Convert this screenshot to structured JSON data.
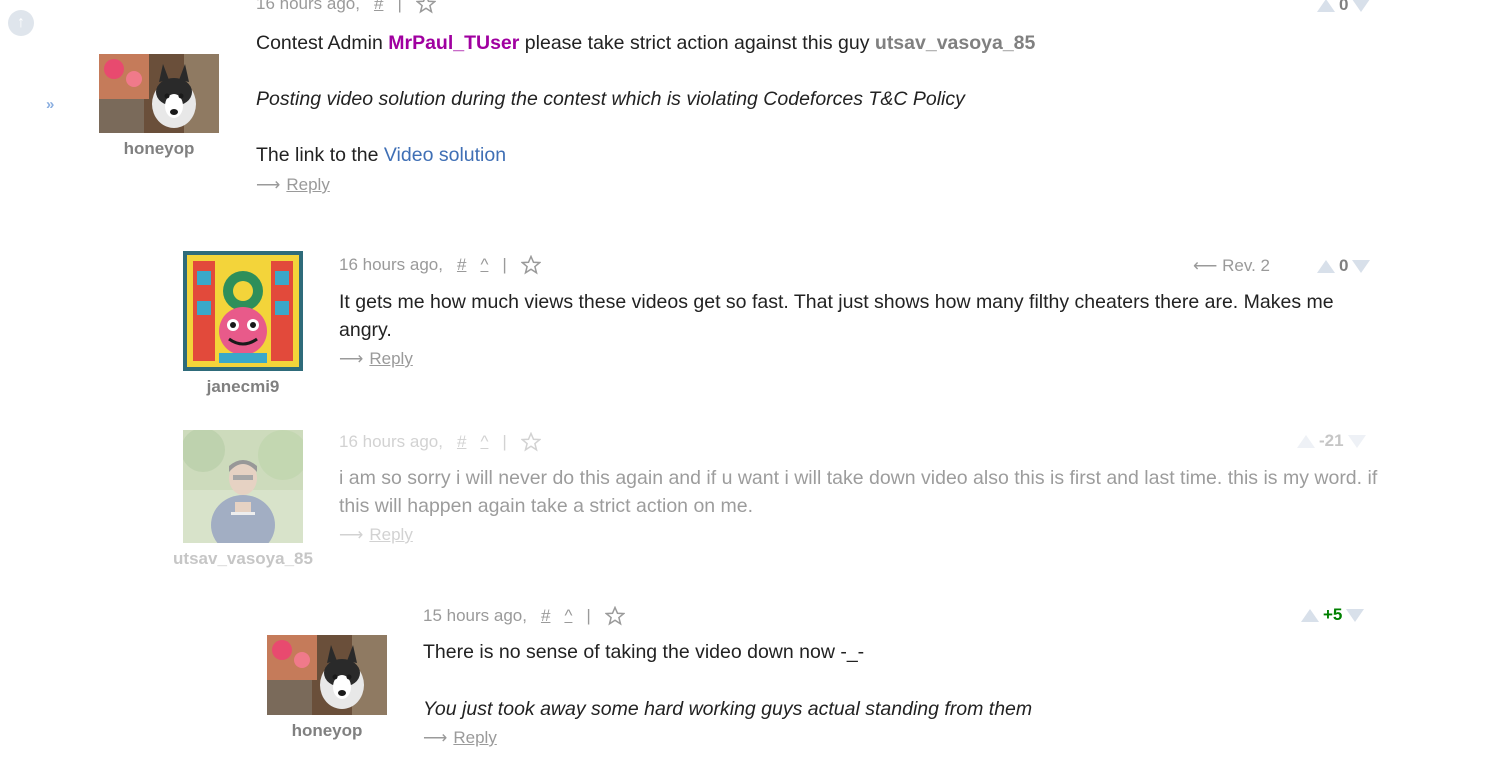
{
  "sidebar": {
    "up_icon": "arrow-up-circle-icon",
    "expand_icon": "double-chevron-right-icon",
    "expand_glyph": "»"
  },
  "comments": [
    {
      "author": "honeyop",
      "time": "16 hours ago,",
      "hash": "#",
      "sep": "|",
      "vote": "0",
      "vote_color": "#808080",
      "text_parts": {
        "p1_a": "Contest Admin ",
        "p1_user_red": "MrPaul_TUser",
        "p1_b": " please take strict action against this guy ",
        "p1_user_gray": "utsav_vasoya_85",
        "p2": "Posting video solution during the contest which is violating Codeforces T&C Policy",
        "p3_a": "The link to the ",
        "p3_link": "Video solution"
      },
      "reply_arrow": "⟶",
      "reply": "Reply"
    },
    {
      "author": "janecmi9",
      "time": "16 hours ago,",
      "hash": "#",
      "caret": "^",
      "sep": "|",
      "rev": "⟵ Rev. 2",
      "vote": "0",
      "vote_color": "#808080",
      "text": "It gets me how much views these videos get so fast. That just shows how many filthy cheaters there are. Makes me angry.",
      "reply_arrow": "⟶",
      "reply": "Reply"
    },
    {
      "author": "utsav_vasoya_85",
      "time": "16 hours ago,",
      "hash": "#",
      "caret": "^",
      "sep": "|",
      "vote": "-21",
      "vote_color": "#808080",
      "text": "i am so sorry i will never do this again and if u want i will take down video also this is first and last time. this is my word. if this will happen again take a strict action on me.",
      "reply_arrow": "⟶",
      "reply": "Reply"
    },
    {
      "author": "honeyop",
      "time": "15 hours ago,",
      "hash": "#",
      "caret": "^",
      "sep": "|",
      "vote": "+5",
      "vote_color": "#008000",
      "text_p1": "There is no sense of taking the video down now -_-",
      "text_p2": "You just took away some hard working guys actual standing from them",
      "reply_arrow": "⟶",
      "reply": "Reply"
    }
  ]
}
